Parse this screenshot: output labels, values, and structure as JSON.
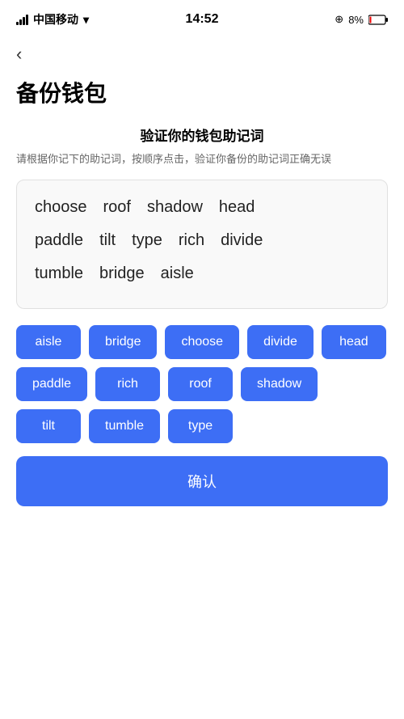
{
  "statusBar": {
    "carrier": "中国移动",
    "time": "14:52",
    "batteryPercent": "8%"
  },
  "backLabel": "‹",
  "pageTitle": "备份钱包",
  "section": {
    "title": "验证你的钱包助记词",
    "desc": "请根据你记下的助记词，按顺序点击，验证你备份的助记词正确无误"
  },
  "displayWords": {
    "row1": [
      "choose",
      "roof",
      "shadow",
      "head"
    ],
    "row2": [
      "paddle",
      "tilt",
      "type",
      "rich",
      "divide"
    ],
    "row3": [
      "tumble",
      "bridge",
      "aisle"
    ]
  },
  "wordButtons": [
    "aisle",
    "bridge",
    "choose",
    "divide",
    "head",
    "paddle",
    "rich",
    "roof",
    "shadow",
    "tilt",
    "tumble",
    "type"
  ],
  "confirmLabel": "确认"
}
